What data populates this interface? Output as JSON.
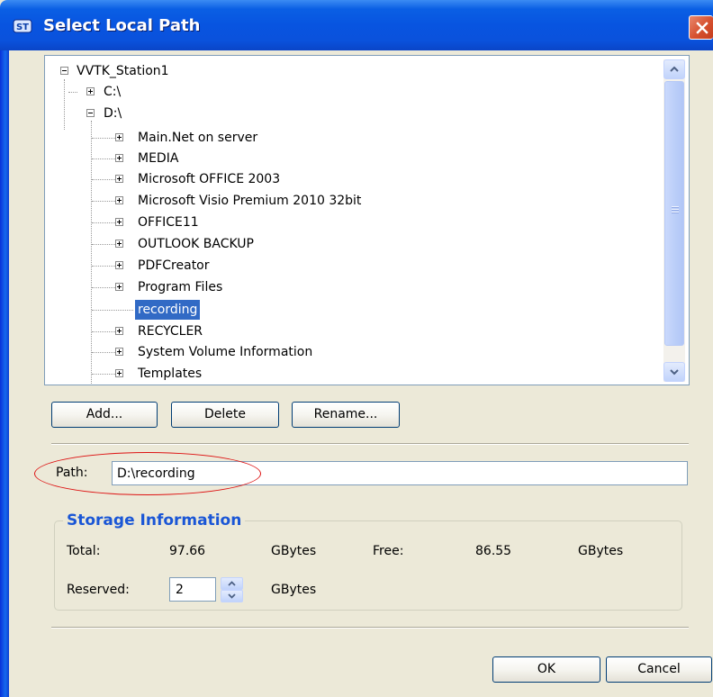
{
  "window": {
    "title": "Select Local Path",
    "title_color": "#0a5fe4",
    "close_icon": "close-icon"
  },
  "tree": {
    "root": "VVTK_Station1",
    "items": [
      {
        "label": "C:\\",
        "level": 1,
        "expander": "plus"
      },
      {
        "label": "D:\\",
        "level": 1,
        "expander": "minus"
      },
      {
        "label": "Main.Net on server",
        "level": 2,
        "expander": "plus"
      },
      {
        "label": "MEDIA",
        "level": 2,
        "expander": "plus"
      },
      {
        "label": "Microsoft OFFICE 2003",
        "level": 2,
        "expander": "plus"
      },
      {
        "label": "Microsoft Visio Premium 2010 32bit",
        "level": 2,
        "expander": "plus"
      },
      {
        "label": "OFFICE11",
        "level": 2,
        "expander": "plus"
      },
      {
        "label": "OUTLOOK BACKUP",
        "level": 2,
        "expander": "plus"
      },
      {
        "label": "PDFCreator",
        "level": 2,
        "expander": "plus"
      },
      {
        "label": "Program Files",
        "level": 2,
        "expander": "plus"
      },
      {
        "label": "recording",
        "level": 2,
        "expander": "none",
        "selected": true
      },
      {
        "label": "RECYCLER",
        "level": 2,
        "expander": "plus"
      },
      {
        "label": "System Volume Information",
        "level": 2,
        "expander": "plus"
      },
      {
        "label": "Templates",
        "level": 2,
        "expander": "plus"
      }
    ],
    "selection_color": "#316ac5"
  },
  "buttons": {
    "add": "Add...",
    "delete": "Delete",
    "rename": "Rename...",
    "ok": "OK",
    "cancel": "Cancel"
  },
  "path": {
    "label": "Path:",
    "value": "D:\\recording",
    "highlight_color": "#dd1111"
  },
  "storage": {
    "title": "Storage Information",
    "title_color": "#1a56d6",
    "total_label": "Total:",
    "total_value": "97.66",
    "total_unit": "GBytes",
    "free_label": "Free:",
    "free_value": "86.55",
    "free_unit": "GBytes",
    "reserved_label": "Reserved:",
    "reserved_value": "2",
    "reserved_unit": "GBytes"
  }
}
